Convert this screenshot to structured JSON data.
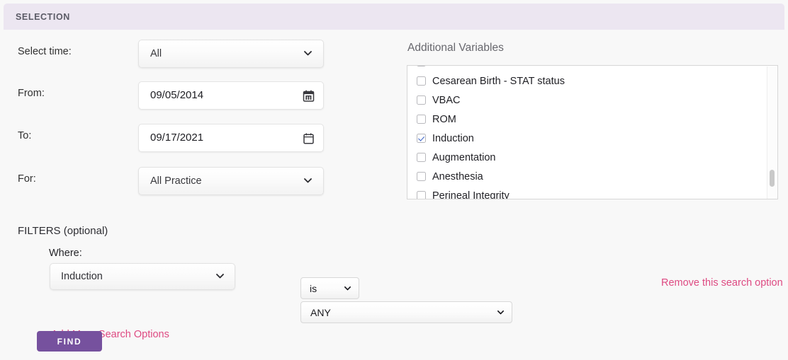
{
  "panel": {
    "header_title": "SELECTION",
    "accent_purple": "#76519e",
    "header_bg": "#ece6f1",
    "link_pink": "#de4a82"
  },
  "selection_form": {
    "select_time": {
      "label": "Select time:",
      "value": "All",
      "icon": "chevron-down-icon"
    },
    "from": {
      "label": "From:",
      "value": "09/05/2014",
      "icon": "calendar-filled-icon"
    },
    "to": {
      "label": "To:",
      "value": "09/17/2021",
      "icon": "calendar-outline-icon"
    },
    "for": {
      "label": "For:",
      "value": "All Practice",
      "icon": "chevron-down-icon"
    }
  },
  "additional_variables": {
    "label": "Additional Variables",
    "items": [
      {
        "label": "",
        "checked": false,
        "clipped": true
      },
      {
        "label": "Cesarean Birth - STAT status",
        "checked": false
      },
      {
        "label": "VBAC",
        "checked": false
      },
      {
        "label": "ROM",
        "checked": false
      },
      {
        "label": "Induction",
        "checked": true
      },
      {
        "label": "Augmentation",
        "checked": false
      },
      {
        "label": "Anesthesia",
        "checked": false
      },
      {
        "label": "Perineal Integrity",
        "checked": false
      }
    ]
  },
  "filters": {
    "title": "FILTERS (optional)",
    "where_label": "Where:",
    "where_value": "Induction",
    "operator_value": "is",
    "criteria_value": "ANY",
    "add_more_label": "Add More Search Options",
    "remove_label": "Remove this search option"
  },
  "actions": {
    "find_label": "FIND"
  }
}
